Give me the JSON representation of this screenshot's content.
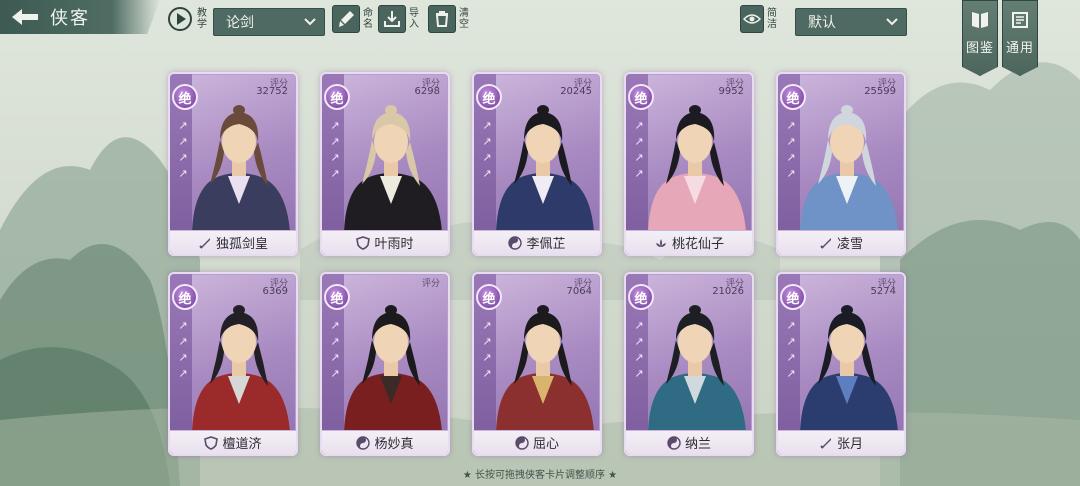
{
  "header": {
    "title": "侠客",
    "tutorial_label": "教学",
    "mode_select": "论剑",
    "rename_label": "命名",
    "import_label": "导入",
    "clear_label": "清空",
    "simple_label": "简洁",
    "sort_select": "默认",
    "codex_label": "图鉴",
    "general_label": "通用"
  },
  "score_label": "评分",
  "cards": [
    {
      "name": "独孤剑皇",
      "score": "32752",
      "rank": "绝",
      "school": "sword",
      "palette": [
        "#3b3d5e",
        "#e9e0f1",
        "#6a4a3b"
      ]
    },
    {
      "name": "叶雨时",
      "score": "6298",
      "rank": "绝",
      "school": "shield",
      "palette": [
        "#1f1d22",
        "#efeae0",
        "#d9c8a8"
      ]
    },
    {
      "name": "李佩芷",
      "score": "20245",
      "rank": "绝",
      "school": "yinyang",
      "palette": [
        "#2e3b6a",
        "#f0ecf3",
        "#1b1b1f"
      ]
    },
    {
      "name": "桃花仙子",
      "score": "9952",
      "rank": "绝",
      "school": "lotus",
      "palette": [
        "#e6a7b9",
        "#f6dbe3",
        "#1d1b22"
      ]
    },
    {
      "name": "凌雪",
      "score": "25599",
      "rank": "绝",
      "school": "sword",
      "palette": [
        "#6f93c6",
        "#eef2f7",
        "#cfd6dd"
      ]
    },
    {
      "name": "檀道济",
      "score": "6369",
      "rank": "绝",
      "school": "shield",
      "palette": [
        "#9b2a2a",
        "#d7d8d6",
        "#222026"
      ]
    },
    {
      "name": "杨妙真",
      "score": "",
      "rank": "绝",
      "school": "yinyang",
      "palette": [
        "#7a1f1f",
        "#3b2a28",
        "#1b1a1d"
      ]
    },
    {
      "name": "屈心",
      "score": "7064",
      "rank": "绝",
      "school": "yinyang",
      "palette": [
        "#8b2f2f",
        "#d9b46d",
        "#1c1a1d"
      ]
    },
    {
      "name": "纳兰",
      "score": "21026",
      "rank": "绝",
      "school": "yinyang",
      "palette": [
        "#2f6c84",
        "#cfd9de",
        "#1c2024"
      ]
    },
    {
      "name": "张月",
      "score": "5274",
      "rank": "绝",
      "school": "sword",
      "palette": [
        "#2b3d6e",
        "#5d7fc0",
        "#1a1c25"
      ]
    }
  ],
  "hint": "★ 长按可拖拽侠客卡片调整顺序 ★",
  "colors": {
    "card_purple": "#a98bc2",
    "toolbar_green": "#4f6a62",
    "background": "#d6ddd2"
  }
}
